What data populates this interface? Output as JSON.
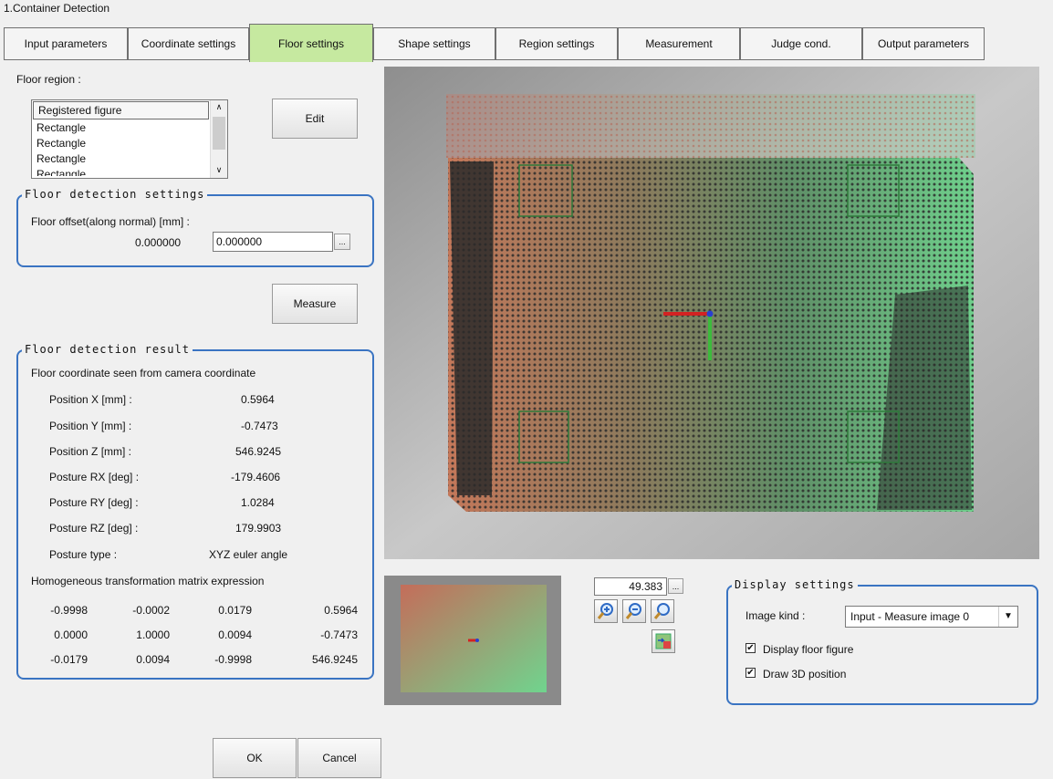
{
  "window": {
    "title": "1.Container Detection"
  },
  "tabs": [
    {
      "label": "Input parameters"
    },
    {
      "label": "Coordinate settings"
    },
    {
      "label": "Floor settings"
    },
    {
      "label": "Shape settings"
    },
    {
      "label": "Region settings"
    },
    {
      "label": "Measurement"
    },
    {
      "label": "Judge cond."
    },
    {
      "label": "Output parameters"
    }
  ],
  "floor_region": {
    "label": "Floor region :",
    "list_header": "Registered figure",
    "items": [
      "Rectangle",
      "Rectangle",
      "Rectangle",
      "Rectangle"
    ],
    "edit_button": "Edit"
  },
  "floor_detection_settings": {
    "title": "Floor detection settings",
    "offset_label": "Floor offset(along normal) [mm] :",
    "current_value": "0.000000",
    "input_value": "0.000000",
    "ellipsis_button": "..."
  },
  "measure_button": "Measure",
  "floor_detection_result": {
    "title": "Floor detection result",
    "subtitle": "Floor coordinate seen from camera coordinate",
    "rows": [
      {
        "label": "Position X [mm] :",
        "value": "0.5964"
      },
      {
        "label": "Position Y [mm] :",
        "value": "-0.7473"
      },
      {
        "label": "Position Z [mm] :",
        "value": "546.9245"
      },
      {
        "label": "Posture RX [deg] :",
        "value": "-179.4606"
      },
      {
        "label": "Posture RY [deg] :",
        "value": "1.0284"
      },
      {
        "label": "Posture RZ [deg] :",
        "value": "179.9903"
      },
      {
        "label": "Posture type :",
        "value": "XYZ euler angle"
      }
    ],
    "matrix_label": "Homogeneous transformation matrix expression",
    "matrix": [
      [
        "-0.9998",
        "-0.0002",
        "0.0179",
        "0.5964"
      ],
      [
        "0.0000",
        "1.0000",
        "0.0094",
        "-0.7473"
      ],
      [
        "-0.0179",
        "0.0094",
        "-0.9998",
        "546.9245"
      ]
    ]
  },
  "zoom": {
    "value": "49.383",
    "ellipsis_button": "..."
  },
  "display_settings": {
    "title": "Display settings",
    "image_kind_label": "Image kind :",
    "image_kind_value": "Input - Measure image 0",
    "display_floor_figure": "Display floor figure",
    "draw_3d_position": "Draw 3D position",
    "display_floor_figure_checked": true,
    "draw_3d_position_checked": true
  },
  "buttons": {
    "ok": "OK",
    "cancel": "Cancel"
  },
  "colors": {
    "active_tab": "#c6e9a0",
    "group_border": "#3a74c2"
  }
}
